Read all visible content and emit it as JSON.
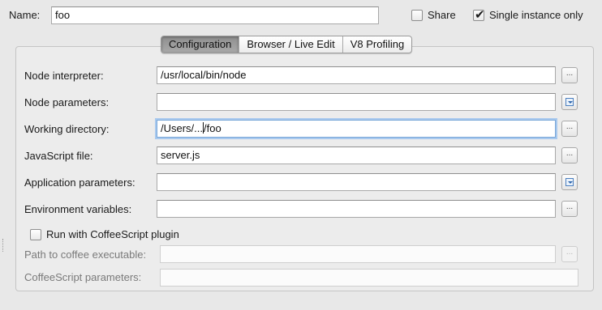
{
  "header": {
    "name_label": "Name:",
    "name_value": "foo",
    "share_label": "Share",
    "share_checked": false,
    "single_instance_label": "Single instance only",
    "single_instance_checked": true
  },
  "tabs": [
    {
      "label": "Configuration",
      "active": true
    },
    {
      "label": "Browser / Live Edit",
      "active": false
    },
    {
      "label": "V8 Profiling",
      "active": false
    }
  ],
  "form": {
    "node_interpreter": {
      "label": "Node interpreter:",
      "value": "/usr/local/bin/node",
      "button_icon": "ellipsis-icon"
    },
    "node_parameters": {
      "label": "Node parameters:",
      "value": "",
      "button_icon": "expand-icon"
    },
    "working_directory": {
      "label": "Working directory:",
      "value_prefix": "/Users/...",
      "value_suffix": "/foo",
      "button_icon": "ellipsis-icon"
    },
    "javascript_file": {
      "label": "JavaScript file:",
      "value": "server.js",
      "button_icon": "ellipsis-icon"
    },
    "application_parameters": {
      "label": "Application parameters:",
      "value": "",
      "button_icon": "expand-icon"
    },
    "environment_variables": {
      "label": "Environment variables:",
      "value": "",
      "button_icon": "ellipsis-icon"
    },
    "coffeescript_plugin": {
      "label": "Run with CoffeeScript plugin",
      "checked": false
    },
    "coffee_executable": {
      "label": "Path to coffee executable:",
      "value": "",
      "button_icon": "ellipsis-icon"
    },
    "coffeescript_parameters": {
      "label": "CoffeeScript parameters:",
      "value": ""
    }
  },
  "button_glyph": "..."
}
